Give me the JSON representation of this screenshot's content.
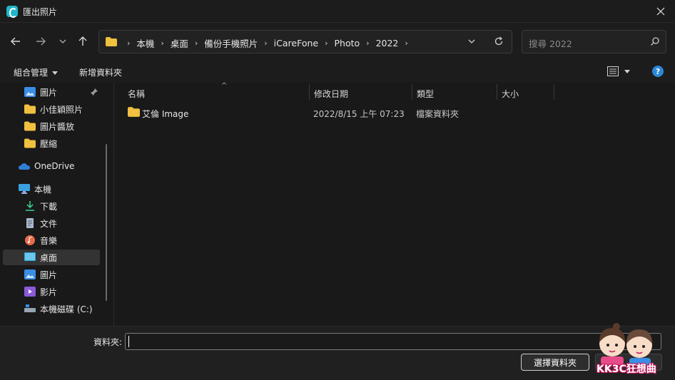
{
  "window": {
    "title": "匯出照片"
  },
  "address": {
    "crumbs": [
      "本機",
      "桌面",
      "備份手機照片",
      "iCareFone",
      "Photo",
      "2022"
    ]
  },
  "search": {
    "placeholder": "搜尋 2022"
  },
  "toolbar": {
    "organize": "組合管理",
    "new_folder": "新增資料夾",
    "help": "?"
  },
  "sidebar": {
    "items": [
      {
        "label": "圖片",
        "icon": "pictures-icon"
      },
      {
        "label": "小佳穎照片",
        "icon": "folder-icon"
      },
      {
        "label": "圖片醬放",
        "icon": "folder-icon"
      },
      {
        "label": "壓縮",
        "icon": "folder-icon"
      },
      {
        "label": "OneDrive",
        "icon": "onedrive-icon"
      },
      {
        "label": "本機",
        "icon": "this-pc-icon"
      },
      {
        "label": "下載",
        "icon": "download-icon"
      },
      {
        "label": "文件",
        "icon": "documents-icon"
      },
      {
        "label": "音樂",
        "icon": "music-icon"
      },
      {
        "label": "桌面",
        "icon": "desktop-icon"
      },
      {
        "label": "圖片",
        "icon": "pictures-icon"
      },
      {
        "label": "影片",
        "icon": "videos-icon"
      },
      {
        "label": "本機磁碟 (C:)",
        "icon": "drive-icon"
      }
    ],
    "selected": "桌面"
  },
  "columns": {
    "name": "名稱",
    "modified": "修改日期",
    "type": "類型",
    "size": "大小"
  },
  "files": [
    {
      "name": "艾倫 Image",
      "modified": "2022/8/15 上午 07:23",
      "type": "檔案資料夾",
      "size": ""
    }
  ],
  "bottom": {
    "folder_label": "資料夾:",
    "folder_value": "",
    "select_button": "選擇資料夾"
  },
  "watermark": {
    "text": "KK3C狂想曲"
  },
  "colors": {
    "accent": "#2b88d8",
    "folder": "#f0c040",
    "background": "#191919"
  }
}
